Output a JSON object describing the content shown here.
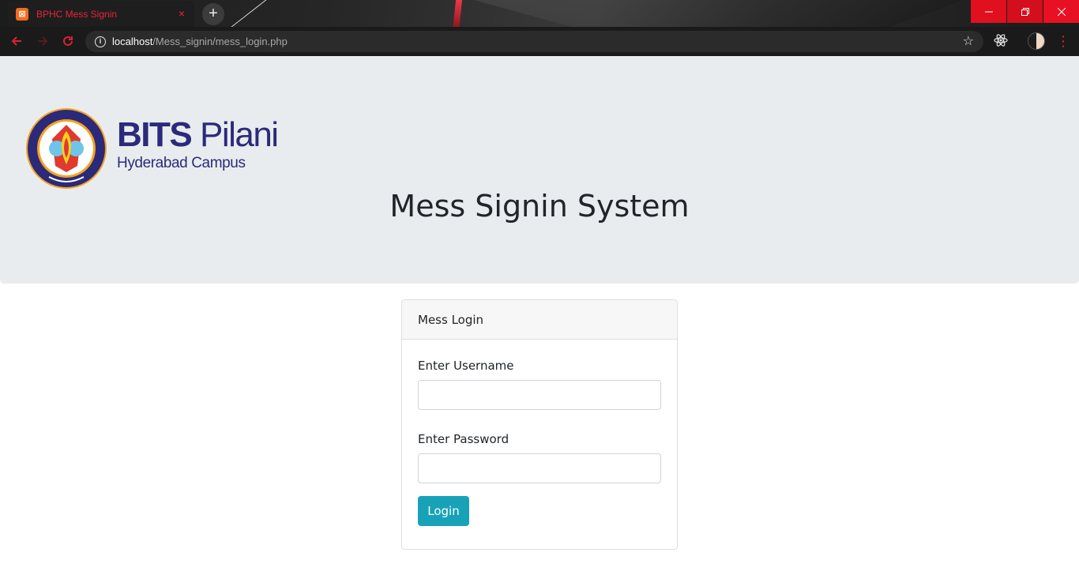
{
  "browser": {
    "tab_title": "BPHC Mess Signin",
    "tab_close": "×",
    "new_tab": "+",
    "url_host": "localhost",
    "url_path": "/Mess_signin/mess_login.php",
    "accent_color": "#e8243a"
  },
  "header": {
    "logo_brand_bold": "BITS",
    "logo_brand_regular": "Pilani",
    "logo_subtitle": "Hyderabad Campus",
    "title": "Mess Signin System"
  },
  "login_card": {
    "header": "Mess Login",
    "username_label": "Enter Username",
    "username_value": "",
    "password_label": "Enter Password",
    "password_value": "",
    "login_button": "Login",
    "button_color": "#17a2b8"
  }
}
